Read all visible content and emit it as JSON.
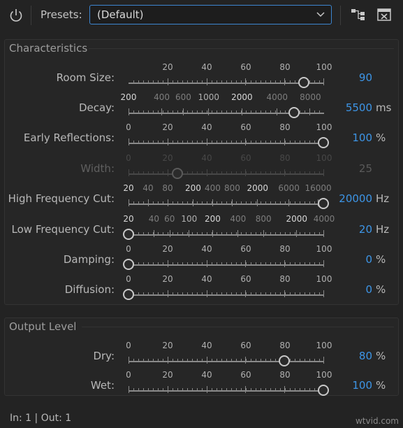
{
  "toolbar": {
    "power_icon": "power-icon",
    "presets_label": "Presets:",
    "preset_value": "(Default)",
    "routing_icon": "routing-icon",
    "close_icon": "close-panel-icon"
  },
  "groups": [
    {
      "title": "Characteristics",
      "rows": [
        {
          "label": "Room Size:",
          "value": "90",
          "unit": "",
          "fraction": 0.9,
          "disabled": false,
          "labels": [
            {
              "t": "20",
              "f": 0.2
            },
            {
              "t": "40",
              "f": 0.4
            },
            {
              "t": "60",
              "f": 0.6
            },
            {
              "t": "80",
              "f": 0.8
            },
            {
              "t": "100",
              "f": 1.0
            }
          ]
        },
        {
          "label": "Decay:",
          "value": "5500",
          "unit": "ms",
          "fraction": 0.85,
          "disabled": false,
          "labels": [
            {
              "t": "200",
              "f": 0.0,
              "s": "b"
            },
            {
              "t": "400",
              "f": 0.17,
              "s": "d"
            },
            {
              "t": "600",
              "f": 0.28,
              "s": "d"
            },
            {
              "t": "1000",
              "f": 0.41
            },
            {
              "t": "2000",
              "f": 0.58,
              "s": "b"
            },
            {
              "t": "4000",
              "f": 0.76,
              "s": "d"
            },
            {
              "t": "8000",
              "f": 0.93,
              "s": "d"
            }
          ]
        },
        {
          "label": "Early Reflections:",
          "value": "100",
          "unit": "%",
          "fraction": 1.0,
          "disabled": false,
          "labels": [
            {
              "t": "0",
              "f": 0.0
            },
            {
              "t": "20",
              "f": 0.2
            },
            {
              "t": "40",
              "f": 0.4
            },
            {
              "t": "60",
              "f": 0.6
            },
            {
              "t": "80",
              "f": 0.8
            },
            {
              "t": "100",
              "f": 1.0
            }
          ]
        },
        {
          "label": "Width:",
          "value": "25",
          "unit": "",
          "fraction": 0.25,
          "disabled": true,
          "labels": [
            {
              "t": "0",
              "f": 0.0
            },
            {
              "t": "20",
              "f": 0.2
            },
            {
              "t": "40",
              "f": 0.4
            },
            {
              "t": "60",
              "f": 0.6
            },
            {
              "t": "80",
              "f": 0.8
            },
            {
              "t": "100",
              "f": 1.0
            }
          ]
        },
        {
          "label": "High Frequency Cut:",
          "value": "20000",
          "unit": "Hz",
          "fraction": 1.0,
          "disabled": false,
          "labels": [
            {
              "t": "20",
              "f": 0.0,
              "s": "b"
            },
            {
              "t": "40",
              "f": 0.1,
              "s": "d"
            },
            {
              "t": "80",
              "f": 0.2,
              "s": "d"
            },
            {
              "t": "200",
              "f": 0.33,
              "s": "b"
            },
            {
              "t": "400",
              "f": 0.43,
              "s": "d"
            },
            {
              "t": "800",
              "f": 0.53,
              "s": "d"
            },
            {
              "t": "2000",
              "f": 0.66,
              "s": "b"
            },
            {
              "t": "6000",
              "f": 0.82,
              "s": "d"
            },
            {
              "t": "16000",
              "f": 0.97,
              "s": "d"
            }
          ]
        },
        {
          "label": "Low Frequency Cut:",
          "value": "20",
          "unit": "Hz",
          "fraction": 0.0,
          "disabled": false,
          "labels": [
            {
              "t": "20",
              "f": 0.0,
              "s": "b"
            },
            {
              "t": "40",
              "f": 0.13,
              "s": "d"
            },
            {
              "t": "60",
              "f": 0.21,
              "s": "d"
            },
            {
              "t": "100",
              "f": 0.31
            },
            {
              "t": "200",
              "f": 0.43,
              "s": "b"
            },
            {
              "t": "400",
              "f": 0.56,
              "s": "d"
            },
            {
              "t": "800",
              "f": 0.69,
              "s": "d"
            },
            {
              "t": "2000",
              "f": 0.86,
              "s": "b"
            },
            {
              "t": "4000",
              "f": 1.0,
              "s": "d"
            }
          ]
        },
        {
          "label": "Damping:",
          "value": "0",
          "unit": "%",
          "fraction": 0.0,
          "disabled": false,
          "labels": [
            {
              "t": "0",
              "f": 0.0
            },
            {
              "t": "20",
              "f": 0.2
            },
            {
              "t": "40",
              "f": 0.4
            },
            {
              "t": "60",
              "f": 0.6
            },
            {
              "t": "80",
              "f": 0.8
            },
            {
              "t": "100",
              "f": 1.0
            }
          ]
        },
        {
          "label": "Diffusion:",
          "value": "0",
          "unit": "%",
          "fraction": 0.0,
          "disabled": false,
          "labels": [
            {
              "t": "0",
              "f": 0.0
            },
            {
              "t": "20",
              "f": 0.2
            },
            {
              "t": "40",
              "f": 0.4
            },
            {
              "t": "60",
              "f": 0.6
            },
            {
              "t": "80",
              "f": 0.8
            },
            {
              "t": "100",
              "f": 1.0
            }
          ]
        }
      ]
    },
    {
      "title": "Output Level",
      "rows": [
        {
          "label": "Dry:",
          "value": "80",
          "unit": "%",
          "fraction": 0.8,
          "disabled": false,
          "labels": [
            {
              "t": "0",
              "f": 0.0
            },
            {
              "t": "20",
              "f": 0.2
            },
            {
              "t": "40",
              "f": 0.4
            },
            {
              "t": "60",
              "f": 0.6
            },
            {
              "t": "80",
              "f": 0.8
            },
            {
              "t": "100",
              "f": 1.0
            }
          ]
        },
        {
          "label": "Wet:",
          "value": "100",
          "unit": "%",
          "fraction": 1.0,
          "disabled": false,
          "labels": [
            {
              "t": "0",
              "f": 0.0
            },
            {
              "t": "20",
              "f": 0.2
            },
            {
              "t": "40",
              "f": 0.4
            },
            {
              "t": "60",
              "f": 0.6
            },
            {
              "t": "80",
              "f": 0.8
            },
            {
              "t": "100",
              "f": 1.0
            }
          ]
        }
      ]
    }
  ],
  "status": "In: 1 | Out: 1",
  "watermark": "wtvid.com",
  "colors": {
    "accent": "#3d95e6",
    "background": "#232323"
  }
}
